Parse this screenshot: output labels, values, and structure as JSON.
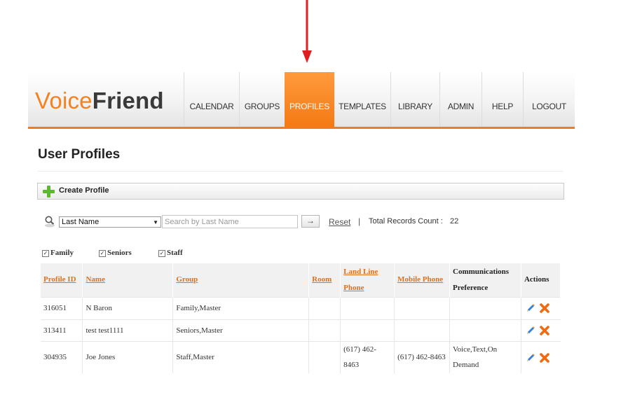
{
  "logo": {
    "voice": "Voice",
    "friend": "Friend"
  },
  "nav": {
    "calendar": "CALENDAR",
    "groups": "GROUPS",
    "profiles": "PROFILES",
    "templates": "TEMPLATES",
    "library": "LIBRARY",
    "admin": "ADMIN",
    "help": "HELP",
    "logout": "LOGOUT",
    "active": "PROFILES"
  },
  "page": {
    "title": "User Profiles"
  },
  "toolbar": {
    "create_label": "Create Profile"
  },
  "search": {
    "field_selected": "Last Name",
    "placeholder": "Search by Last Name",
    "go_glyph": "→",
    "reset_label": "Reset",
    "separator": "|",
    "total_label": "Total Records Count :",
    "total_count": "22"
  },
  "filters": [
    {
      "label": "Family",
      "checked": true
    },
    {
      "label": "Seniors",
      "checked": true
    },
    {
      "label": "Staff",
      "checked": true
    }
  ],
  "table": {
    "headers": {
      "profile_id": "Profile ID",
      "name": "Name",
      "group": "Group",
      "room": "Room",
      "land_line": "Land Line Phone",
      "mobile": "Mobile Phone",
      "comm_pref": "Communications Preference",
      "actions": "Actions"
    },
    "rows": [
      {
        "profile_id": "316051",
        "name": "N Baron",
        "group": "Family,Master",
        "room": "",
        "land_line": "",
        "mobile": "",
        "comm_pref": ""
      },
      {
        "profile_id": "313411",
        "name": "test test1111",
        "group": "Seniors,Master",
        "room": "",
        "land_line": "",
        "mobile": "",
        "comm_pref": ""
      },
      {
        "profile_id": "304935",
        "name": "Joe Jones",
        "group": "Staff,Master",
        "room": "",
        "land_line": "(617) 462-8463",
        "mobile": "(617) 462-8463",
        "comm_pref": "Voice,Text,On Demand"
      }
    ]
  },
  "icons": {
    "arrow": "down-arrow-icon",
    "create": "plus-icon",
    "search": "magnifier-icon",
    "edit": "pencil-icon",
    "delete": "x-icon"
  },
  "colors": {
    "brand_orange": "#f58220",
    "link_orange": "#e0701c",
    "arrow_red": "#e02020",
    "plus_green": "#5cb82e",
    "delete_orange": "#f06a10"
  }
}
